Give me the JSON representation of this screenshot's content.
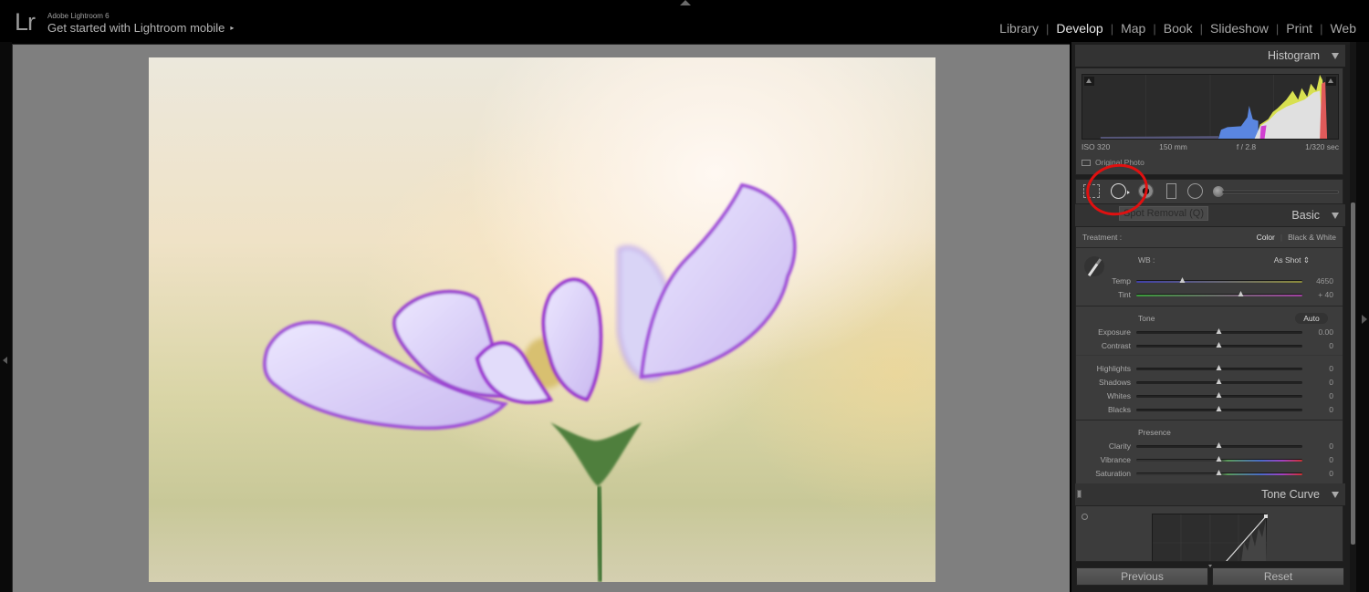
{
  "app": {
    "logo": "Lr",
    "name": "Adobe Lightroom 6",
    "identity_plate": "Get started with Lightroom mobile",
    "identity_arrow": "▸"
  },
  "modules": [
    {
      "label": "Library",
      "active": false
    },
    {
      "label": "Develop",
      "active": true
    },
    {
      "label": "Map",
      "active": false
    },
    {
      "label": "Book",
      "active": false
    },
    {
      "label": "Slideshow",
      "active": false
    },
    {
      "label": "Print",
      "active": false
    },
    {
      "label": "Web",
      "active": false
    }
  ],
  "module_separator": "|",
  "histogram": {
    "title": "Histogram",
    "exif": {
      "iso": "ISO 320",
      "focal_length": "150 mm",
      "aperture": "f / 2.8",
      "shutter": "1/320 sec"
    },
    "original_photo_label": "Original Photo"
  },
  "tools": {
    "tooltip": "Spot Removal (Q)",
    "items": [
      "crop-overlay",
      "spot-removal",
      "red-eye-correction",
      "graduated-filter",
      "radial-filter",
      "adjustment-brush"
    ],
    "selected": "spot-removal"
  },
  "basic": {
    "title": "Basic",
    "treatment_label": "Treatment :",
    "treatment_options": [
      {
        "label": "Color",
        "active": true
      },
      {
        "label": "Black & White",
        "active": false
      }
    ],
    "treatment_separator": "|",
    "wb_label": "WB :",
    "wb_value": "As Shot ⇕",
    "temp": {
      "label": "Temp",
      "value": "4650",
      "position": 0.28
    },
    "tint": {
      "label": "Tint",
      "value": "+ 40",
      "position": 0.63
    },
    "tone_label": "Tone",
    "auto_label": "Auto",
    "tone_sliders": [
      {
        "label": "Exposure",
        "value": "0.00",
        "position": 0.5
      },
      {
        "label": "Contrast",
        "value": "0",
        "position": 0.5
      }
    ],
    "region_sliders": [
      {
        "label": "Highlights",
        "value": "0",
        "position": 0.5
      },
      {
        "label": "Shadows",
        "value": "0",
        "position": 0.5
      },
      {
        "label": "Whites",
        "value": "0",
        "position": 0.5
      },
      {
        "label": "Blacks",
        "value": "0",
        "position": 0.5
      }
    ],
    "presence_label": "Presence",
    "presence_sliders": [
      {
        "label": "Clarity",
        "value": "0",
        "position": 0.5
      },
      {
        "label": "Vibrance",
        "value": "0",
        "position": 0.5
      },
      {
        "label": "Saturation",
        "value": "0",
        "position": 0.5
      }
    ]
  },
  "tone_curve": {
    "title": "Tone Curve"
  },
  "buttons": {
    "previous": "Previous",
    "reset": "Reset"
  },
  "annotation": {
    "color": "#e01010"
  }
}
